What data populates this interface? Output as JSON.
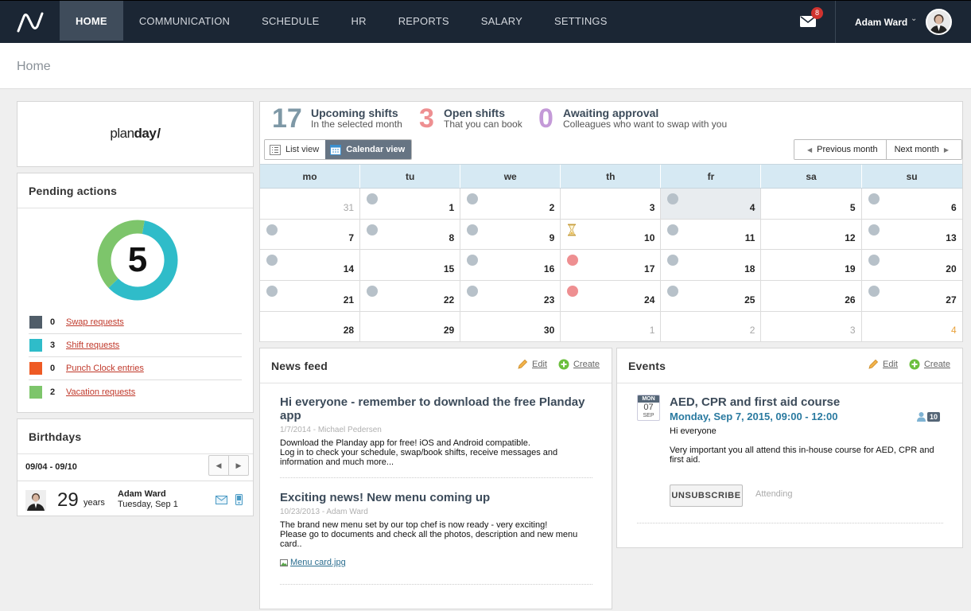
{
  "nav": {
    "items": [
      {
        "label": "HOME",
        "active": true
      },
      {
        "label": "COMMUNICATION"
      },
      {
        "label": "SCHEDULE"
      },
      {
        "label": "HR"
      },
      {
        "label": "REPORTS"
      },
      {
        "label": "SALARY"
      },
      {
        "label": "SETTINGS"
      }
    ],
    "mail_count": "8",
    "user_name": "Adam Ward"
  },
  "page": {
    "title": "Home"
  },
  "brand": {
    "part1": "plan",
    "part2": "day"
  },
  "pending": {
    "title": "Pending actions",
    "total": "5",
    "rows": [
      {
        "count": "0",
        "label": "Swap requests",
        "color": "#505d69"
      },
      {
        "count": "3",
        "label": "Shift requests",
        "color": "#2fbcc9"
      },
      {
        "count": "0",
        "label": "Punch Clock entries",
        "color": "#ee5a24"
      },
      {
        "count": "2",
        "label": "Vacation requests",
        "color": "#7dc56b"
      }
    ]
  },
  "birthdays": {
    "title": "Birthdays",
    "range": "09/04 - 09/10",
    "person": {
      "age": "29",
      "years_label": "years",
      "name": "Adam Ward",
      "date": "Tuesday, Sep 1"
    }
  },
  "stats": [
    {
      "value": "17",
      "label": "Upcoming shifts",
      "sub": "In the selected month",
      "color": "#7e98a6"
    },
    {
      "value": "3",
      "label": "Open shifts",
      "sub": "That you can book",
      "color": "#ee8f91"
    },
    {
      "value": "0",
      "label": "Awaiting approval",
      "sub": "Colleagues who want to swap with you",
      "color": "#c49ad8"
    }
  ],
  "calendar": {
    "views": {
      "list": "List view",
      "calendar": "Calendar view"
    },
    "prev": "Previous month",
    "next": "Next month",
    "weekdays": [
      "mo",
      "tu",
      "we",
      "th",
      "fr",
      "sa",
      "su"
    ],
    "weeks": [
      [
        {
          "d": "31",
          "other": true
        },
        {
          "d": "1",
          "m": "grey"
        },
        {
          "d": "2",
          "m": "grey"
        },
        {
          "d": "3"
        },
        {
          "d": "4",
          "m": "grey",
          "today": true
        },
        {
          "d": "5"
        },
        {
          "d": "6",
          "m": "grey"
        }
      ],
      [
        {
          "d": "7",
          "m": "grey"
        },
        {
          "d": "8",
          "m": "grey"
        },
        {
          "d": "9",
          "m": "grey"
        },
        {
          "d": "10",
          "m": "hourglass"
        },
        {
          "d": "11",
          "m": "grey"
        },
        {
          "d": "12"
        },
        {
          "d": "13",
          "m": "grey"
        }
      ],
      [
        {
          "d": "14",
          "m": "grey"
        },
        {
          "d": "15"
        },
        {
          "d": "16",
          "m": "grey"
        },
        {
          "d": "17",
          "m": "red"
        },
        {
          "d": "18",
          "m": "grey"
        },
        {
          "d": "19"
        },
        {
          "d": "20",
          "m": "grey"
        }
      ],
      [
        {
          "d": "21",
          "m": "grey"
        },
        {
          "d": "22",
          "m": "grey"
        },
        {
          "d": "23",
          "m": "grey"
        },
        {
          "d": "24",
          "m": "red"
        },
        {
          "d": "25",
          "m": "grey"
        },
        {
          "d": "26"
        },
        {
          "d": "27",
          "m": "grey"
        }
      ],
      [
        {
          "d": "28"
        },
        {
          "d": "29"
        },
        {
          "d": "30"
        },
        {
          "d": "1",
          "other": true
        },
        {
          "d": "2",
          "other": true
        },
        {
          "d": "3",
          "other": true
        },
        {
          "d": "4",
          "other": true,
          "orange": true
        }
      ]
    ]
  },
  "news": {
    "title": "News feed",
    "edit": "Edit",
    "create": "Create",
    "items": [
      {
        "title": "Hi everyone - remember to download the free Planday app",
        "meta": "1/7/2014 - Michael Pedersen",
        "body": "Download the Planday app for free! iOS and Android compatible.\nLog in to check your schedule, swap/book shifts, receive messages and information and much more..."
      },
      {
        "title": "Exciting news! New menu coming up",
        "meta": "10/23/2013 - Adam Ward",
        "body": "The brand new menu set by our top chef is now ready - very exciting!\nPlease go to documents and check all the photos, description and new menu card..",
        "attachment": "Menu card.jpg"
      }
    ]
  },
  "events": {
    "title": "Events",
    "edit": "Edit",
    "create": "Create",
    "item": {
      "badge_dow": "MON",
      "badge_day": "07",
      "badge_month": "SEP",
      "title": "AED, CPR and first aid course",
      "when": "Monday,  Sep 7, 2015, 09:00 - 12:00",
      "attendees": "10",
      "greeting": "Hi everyone",
      "body": "Very important you all attend this in-house course for AED, CPR and first aid.",
      "button": "UNSUBSCRIBE",
      "status": "Attending"
    }
  }
}
